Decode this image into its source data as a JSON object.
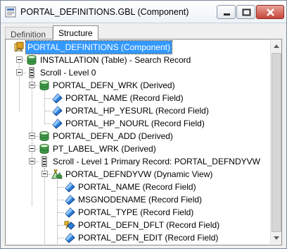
{
  "window": {
    "title": "PORTAL_DEFINITIONS.GBL (Component)"
  },
  "tabs": [
    {
      "label": "Definition",
      "active": false
    },
    {
      "label": "Structure",
      "active": true
    }
  ],
  "tree": {
    "nodes": [
      {
        "label": "PORTAL_DEFINITIONS (Component)",
        "icon": "component-icon",
        "expander": false,
        "selected": true
      },
      {
        "label": "INSTALLATION (Table) - Search Record",
        "icon": "table-record-icon",
        "expander": true
      },
      {
        "label": "Scroll - Level 0",
        "icon": "scroll-icon",
        "expander": true
      },
      {
        "label": "PORTAL_DEFN_WRK (Derived)",
        "icon": "derived-record-icon",
        "expander": true
      },
      {
        "label": "PORTAL_NAME (Record Field)",
        "icon": "record-field-icon",
        "expander": false
      },
      {
        "label": "PORTAL_HP_YESURL (Record Field)",
        "icon": "record-field-icon",
        "expander": false
      },
      {
        "label": "PORTAL_HP_NOURL (Record Field)",
        "icon": "record-field-icon",
        "expander": false
      },
      {
        "label": "PORTAL_DEFN_ADD (Derived)",
        "icon": "derived-record-icon",
        "expander": true
      },
      {
        "label": "PT_LABEL_WRK (Derived)",
        "icon": "derived-record-icon",
        "expander": true
      },
      {
        "label": "Scroll - Level 1  Primary Record: PORTAL_DEFNDYVW",
        "icon": "scroll-icon",
        "expander": true
      },
      {
        "label": "PORTAL_DEFNDYVW (Dynamic View)",
        "icon": "dynamic-view-icon",
        "expander": true
      },
      {
        "label": "PORTAL_NAME (Record Field)",
        "icon": "record-field-icon",
        "expander": false
      },
      {
        "label": "MSGNODENAME (Record Field)",
        "icon": "record-field-icon",
        "expander": false
      },
      {
        "label": "PORTAL_TYPE (Record Field)",
        "icon": "record-field-icon",
        "expander": false
      },
      {
        "label": "PORTAL_DEFN_DFLT (Record Field)",
        "icon": "peoplecode-field-icon",
        "expander": false
      },
      {
        "label": "PORTAL_DEFN_EDIT (Record Field)",
        "icon": "record-field-icon",
        "expander": false
      }
    ]
  },
  "colors": {
    "selection": "#3399ff",
    "field_diamond": "#2b7fd6",
    "record_cylinder": "#3a9a4a",
    "component_icon": "#e0a020"
  }
}
